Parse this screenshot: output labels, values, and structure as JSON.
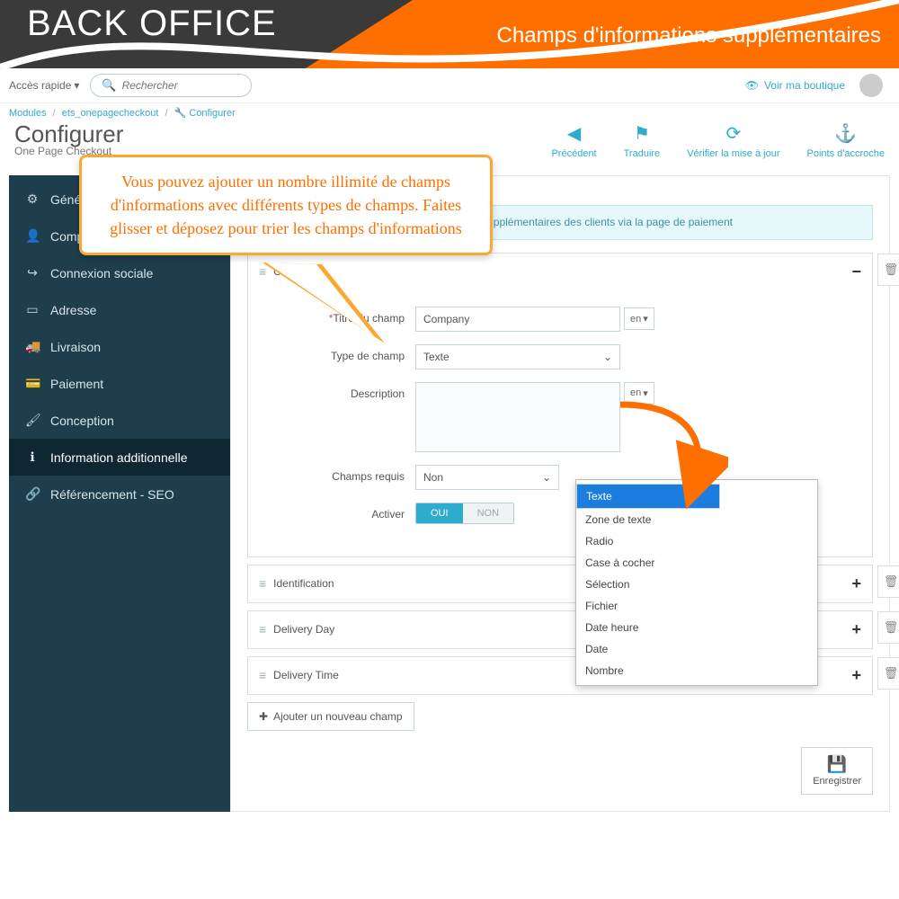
{
  "banner": {
    "left": "BACK OFFICE",
    "right": "Champs d'informations supplémentaires"
  },
  "topbar": {
    "quick_access": "Accès rapide",
    "search_placeholder": "Rechercher",
    "view_shop": "Voir ma boutique"
  },
  "crumbs": {
    "a": "Modules",
    "b": "ets_onepagecheckout",
    "c": "Configurer"
  },
  "page": {
    "title": "Configurer",
    "subtitle": "One Page Checkout"
  },
  "head_actions": {
    "back": "Précédent",
    "translate": "Traduire",
    "update": "Vérifier la mise à jour",
    "hooks": "Points d'accroche"
  },
  "sidebar": {
    "items": [
      {
        "icon": "⚙",
        "label": "Général"
      },
      {
        "icon": "👤",
        "label": "Compte"
      },
      {
        "icon": "↪",
        "label": "Connexion sociale"
      },
      {
        "icon": "▭",
        "label": "Adresse"
      },
      {
        "icon": "🚚",
        "label": "Livraison"
      },
      {
        "icon": "💳",
        "label": "Paiement"
      },
      {
        "icon": "🖌",
        "label": "Conception"
      },
      {
        "icon": "ℹ",
        "label": "Information additionnelle"
      },
      {
        "icon": "🔗",
        "label": "Référencement - SEO"
      }
    ]
  },
  "info_banner": "… plémentaires pour obtenir des informations supplémentaires des clients via la page de paiement",
  "labels": {
    "field_title": "Titre du champ",
    "field_type": "Type de champ",
    "description": "Description",
    "required": "Champs requis",
    "enable": "Activer",
    "lang": "en",
    "toggle_on": "OUI",
    "toggle_off": "NON",
    "add_field": "Ajouter un nouveau champ",
    "save": "Enregistrer"
  },
  "panels": {
    "company": {
      "title": "Company",
      "field_title_value": "Company",
      "type_value": "Texte",
      "required_value": "Non"
    },
    "others": [
      {
        "title": "Identification"
      },
      {
        "title": "Delivery Day"
      },
      {
        "title": "Delivery Time"
      }
    ]
  },
  "dropdown_options": [
    "Texte",
    "Zone de texte",
    "Radio",
    "Case à cocher",
    "Sélection",
    "Fichier",
    "Date heure",
    "Date",
    "Nombre"
  ],
  "callout": "Vous pouvez ajouter un nombre illimité de champs d'informations avec différents types de champs. Faites glisser et déposez pour trier les champs d'informations"
}
